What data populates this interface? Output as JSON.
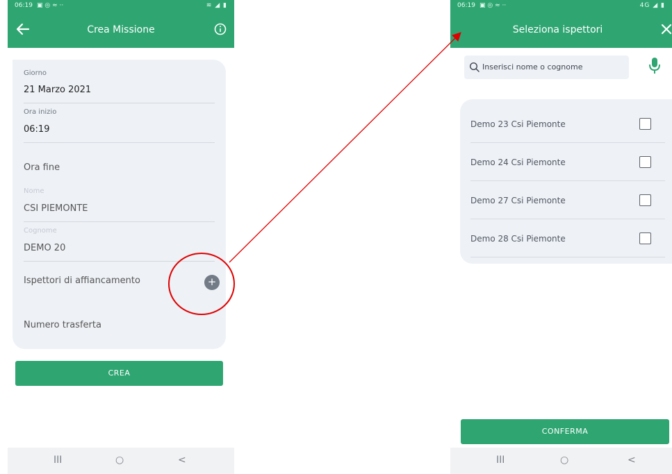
{
  "left_screen": {
    "status": {
      "time": "06:19",
      "icons": "▣ ◎ ≈ ··",
      "right_icons": "≋ ◢ ▮"
    },
    "appbar": {
      "title": "Crea Missione"
    },
    "form": {
      "giorno": {
        "label": "Giorno",
        "value": "21 Marzo 2021"
      },
      "ora_inizio": {
        "label": "Ora inizio",
        "value": "06:19"
      },
      "ora_fine": {
        "label": "Ora fine"
      },
      "nome": {
        "label": "Nome",
        "value": "CSI PIEMONTE"
      },
      "cognome": {
        "label": "Cognome",
        "value": "DEMO 20"
      },
      "ispettori": {
        "label": "Ispettori di affiancamento",
        "add_symbol": "+"
      },
      "numero_trasferta": {
        "label": "Numero trasferta"
      }
    },
    "submit": {
      "label": "CREA"
    },
    "navbar": {
      "recent": "III",
      "home": "○",
      "back": "<"
    }
  },
  "right_screen": {
    "status": {
      "time": "06:19",
      "icons": "▣ ◎ ≈ ··",
      "right_icons": "4G ◢ ▮"
    },
    "appbar": {
      "title": "Seleziona ispettori"
    },
    "search": {
      "placeholder": "Inserisci nome o cognome"
    },
    "inspectors": [
      {
        "name": "Demo 23 Csi Piemonte",
        "checked": false
      },
      {
        "name": "Demo 24 Csi Piemonte",
        "checked": false
      },
      {
        "name": "Demo 27 Csi Piemonte",
        "checked": false
      },
      {
        "name": "Demo 28 Csi Piemonte",
        "checked": false
      }
    ],
    "confirm": {
      "label": "CONFERMA"
    },
    "navbar": {
      "recent": "III",
      "home": "○",
      "back": "<"
    }
  },
  "colors": {
    "primary": "#2fa672",
    "card": "#eef1f6",
    "annotation": "#e00000"
  },
  "icons": [
    "back-arrow-icon",
    "info-icon",
    "plus-icon",
    "search-icon",
    "mic-icon",
    "close-icon"
  ]
}
